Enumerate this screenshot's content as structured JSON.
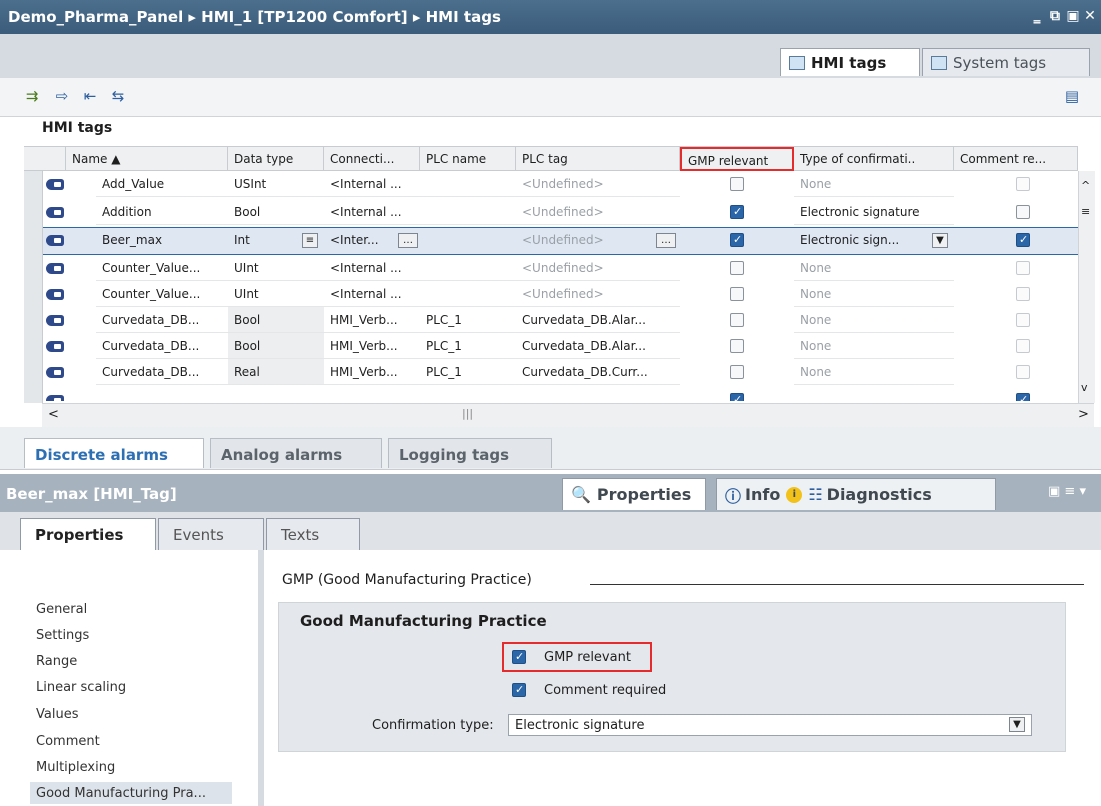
{
  "window": {
    "breadcrumb": "Demo_Pharma_Panel ▸ HMI_1 [TP1200 Comfort] ▸ HMI tags"
  },
  "view_tabs": {
    "hmi_tags": "HMI tags",
    "system_tags": "System tags"
  },
  "grid": {
    "title": "HMI tags",
    "columns": [
      "Name ▲",
      "Data type",
      "Connecti...",
      "PLC name",
      "PLC tag",
      "GMP relevant",
      "Type of confirmati..",
      "Comment re..."
    ],
    "rows": [
      {
        "name": "Add_Value",
        "data_type": "USInt",
        "connection": "<Internal ...",
        "plc_name": "",
        "plc_tag": "<Undefined>",
        "gmp": false,
        "confirmation": "None",
        "comment": false
      },
      {
        "name": "Addition",
        "data_type": "Bool",
        "connection": "<Internal ...",
        "plc_name": "",
        "plc_tag": "<Undefined>",
        "gmp": true,
        "confirmation": "Electronic signature",
        "comment": false
      },
      {
        "name": "Beer_max",
        "data_type": "Int",
        "connection": "<Inter...",
        "plc_name": "",
        "plc_tag": "<Undefined>",
        "gmp": true,
        "confirmation": "Electronic sign...",
        "comment": true
      },
      {
        "name": "Counter_Value...",
        "data_type": "UInt",
        "connection": "<Internal ...",
        "plc_name": "",
        "plc_tag": "<Undefined>",
        "gmp": false,
        "confirmation": "None",
        "comment": false
      },
      {
        "name": "Counter_Value...",
        "data_type": "UInt",
        "connection": "<Internal ...",
        "plc_name": "",
        "plc_tag": "<Undefined>",
        "gmp": false,
        "confirmation": "None",
        "comment": false
      },
      {
        "name": "Curvedata_DB...",
        "data_type": "Bool",
        "connection": "HMI_Verb...",
        "plc_name": "PLC_1",
        "plc_tag": "Curvedata_DB.Alar...",
        "gmp": false,
        "confirmation": "None",
        "comment": false
      },
      {
        "name": "Curvedata_DB...",
        "data_type": "Bool",
        "connection": "HMI_Verb...",
        "plc_name": "PLC_1",
        "plc_tag": "Curvedata_DB.Alar...",
        "gmp": false,
        "confirmation": "None",
        "comment": false
      },
      {
        "name": "Curvedata_DB...",
        "data_type": "Real",
        "connection": "HMI_Verb...",
        "plc_name": "PLC_1",
        "plc_tag": "Curvedata_DB.Curr...",
        "gmp": false,
        "confirmation": "None",
        "comment": false
      }
    ]
  },
  "bottom_tabs": {
    "discrete": "Discrete alarms",
    "analog": "Analog alarms",
    "logging": "Logging tags"
  },
  "inspector": {
    "object": "Beer_max [HMI_Tag]",
    "tabs": {
      "properties": "Properties",
      "info": "Info",
      "diagnostics": "Diagnostics"
    },
    "subtabs": {
      "properties": "Properties",
      "events": "Events",
      "texts": "Texts"
    },
    "nav": [
      "General",
      "Settings",
      "Range",
      "Linear scaling",
      "Values",
      "Comment",
      "Multiplexing",
      "Good Manufacturing Pra..."
    ],
    "section_heading": "GMP (Good Manufacturing Practice)",
    "group_title": "Good Manufacturing Practice",
    "gmp_relevant": "GMP relevant",
    "comment_required": "Comment required",
    "confirmation_label": "Confirmation type:",
    "confirmation_value": "Electronic signature"
  }
}
